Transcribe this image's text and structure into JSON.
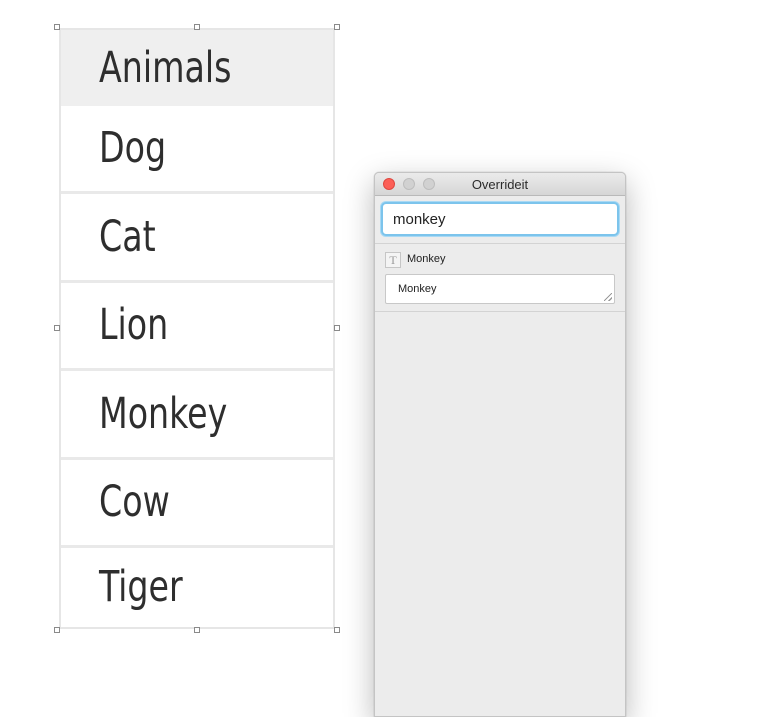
{
  "artboard": {
    "header": "Animals",
    "rows": [
      "Dog",
      "Cat",
      "Lion",
      "Monkey",
      "Cow",
      "Tiger"
    ]
  },
  "panel": {
    "title": "Overrideit",
    "search_value": "monkey",
    "result": {
      "icon": "text-layer-icon",
      "icon_glyph": "T",
      "name": "Monkey",
      "value": "Monkey"
    }
  },
  "colors": {
    "accent_focus": "#7cc4ec",
    "close_button": "#fc5f57",
    "header_bg": "#efefef"
  }
}
